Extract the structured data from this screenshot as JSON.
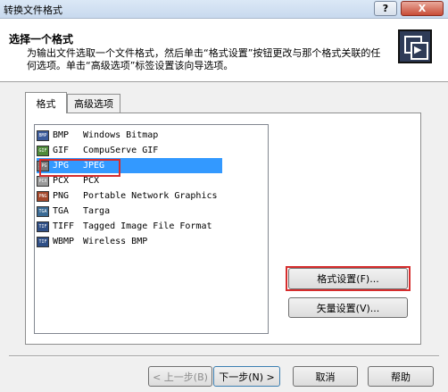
{
  "window": {
    "title": "转换文件格式",
    "help_button": "?",
    "close_button": "X"
  },
  "header": {
    "title": "选择一个格式",
    "description": "为输出文件选取一个文件格式，然后单击“格式设置”按钮更改与那个格式关联的任何选项。单击“高级选项”标签设置该向导选项。"
  },
  "tabs": [
    {
      "label": "格式"
    },
    {
      "label": "高级选项"
    }
  ],
  "formats": [
    {
      "icon": "BMP",
      "ext": "BMP",
      "desc": "Windows Bitmap",
      "icon_color": "#3b5b9c"
    },
    {
      "icon": "GIF",
      "ext": "GIF",
      "desc": "CompuServe GIF",
      "icon_color": "#4f8a3a"
    },
    {
      "icon": "JPG",
      "ext": "JPG",
      "desc": "JPEG",
      "icon_color": "#7a7a7a",
      "selected": true
    },
    {
      "icon": "PCX",
      "ext": "PCX",
      "desc": "PCX",
      "icon_color": "#9a9a9a"
    },
    {
      "icon": "PNG",
      "ext": "PNG",
      "desc": "Portable Network Graphics",
      "icon_color": "#a4472a"
    },
    {
      "icon": "TGA",
      "ext": "TGA",
      "desc": "Targa",
      "icon_color": "#3a6a94"
    },
    {
      "icon": "TIF",
      "ext": "TIFF",
      "desc": "Tagged Image File Format",
      "icon_color": "#2f4f86"
    },
    {
      "icon": "TIF",
      "ext": "WBMP",
      "desc": "Wireless BMP",
      "icon_color": "#2f4f86"
    }
  ],
  "buttons": {
    "format_settings": "格式设置(F)...",
    "vector_settings": "矢量设置(V)...",
    "back": "< 上一步(B)",
    "next": "下一步(N) >",
    "cancel": "取消",
    "help": "帮助"
  },
  "colors": {
    "selection": "#3399ff",
    "highlight_box": "#d62d2d"
  }
}
